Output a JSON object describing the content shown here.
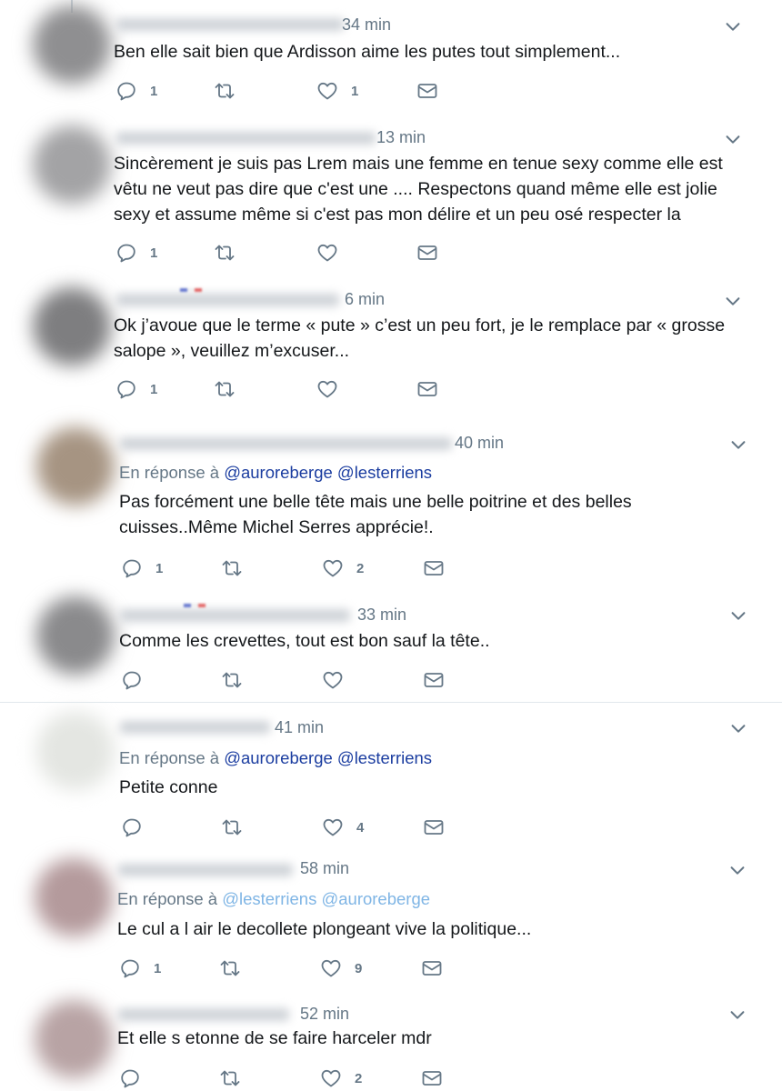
{
  "colors": {
    "text": "#14171a",
    "muted": "#657786",
    "handle": "#1b3da0",
    "handle_light": "#7fb5e5",
    "divider": "#e1e8ed"
  },
  "icons": {
    "reply": "reply-icon",
    "retweet": "retweet-icon",
    "like": "heart-icon",
    "dm": "envelope-icon",
    "menu": "chevron-down-icon"
  },
  "tweets": [
    {
      "time": "34 min",
      "lines": [
        "Ben elle sait bien que Ardisson aime les putes tout simplement..."
      ],
      "replies": "1",
      "retweets": "",
      "likes": "1"
    },
    {
      "time": "13 min",
      "lines": [
        "Sincèrement je suis pas Lrem mais une femme en tenue sexy comme elle est",
        "vêtu ne veut pas dire que c'est une .... Respectons quand même elle est jolie",
        "sexy et assume même si c'est pas mon délire et un peu osé respecter la"
      ],
      "replies": "1",
      "retweets": "",
      "likes": ""
    },
    {
      "time": "6 min",
      "lines": [
        "Ok j’avoue que le terme « pute » c’est un peu fort, je le remplace par « grosse",
        "salope », veuillez m’excuser..."
      ],
      "replies": "1",
      "retweets": "",
      "likes": ""
    },
    {
      "time": "40 min",
      "reply_prefix": "En réponse à",
      "reply_handles": [
        "@auroreberge",
        "@lesterriens"
      ],
      "lines": [
        "Pas forcément une belle tête mais une belle poitrine et des belles",
        "cuisses..Même Michel Serres apprécie!."
      ],
      "replies": "1",
      "retweets": "",
      "likes": "2"
    },
    {
      "time": "33 min",
      "lines": [
        "Comme les crevettes, tout est bon sauf la tête.."
      ],
      "replies": "",
      "retweets": "",
      "likes": ""
    },
    {
      "time": "41 min",
      "reply_prefix": "En réponse à",
      "reply_handles": [
        "@auroreberge",
        "@lesterriens"
      ],
      "lines": [
        "Petite conne"
      ],
      "replies": "",
      "retweets": "",
      "likes": "4"
    },
    {
      "time": "58 min",
      "reply_prefix": "En réponse à",
      "reply_handles": [
        "@lesterriens",
        "@auroreberge"
      ],
      "lines": [
        "Le cul a l air le decollete plongeant vive la politique..."
      ],
      "replies": "1",
      "retweets": "",
      "likes": "9"
    },
    {
      "time": "52 min",
      "lines": [
        "Et elle s etonne de se faire harceler mdr"
      ],
      "replies": "",
      "retweets": "",
      "likes": "2"
    }
  ]
}
